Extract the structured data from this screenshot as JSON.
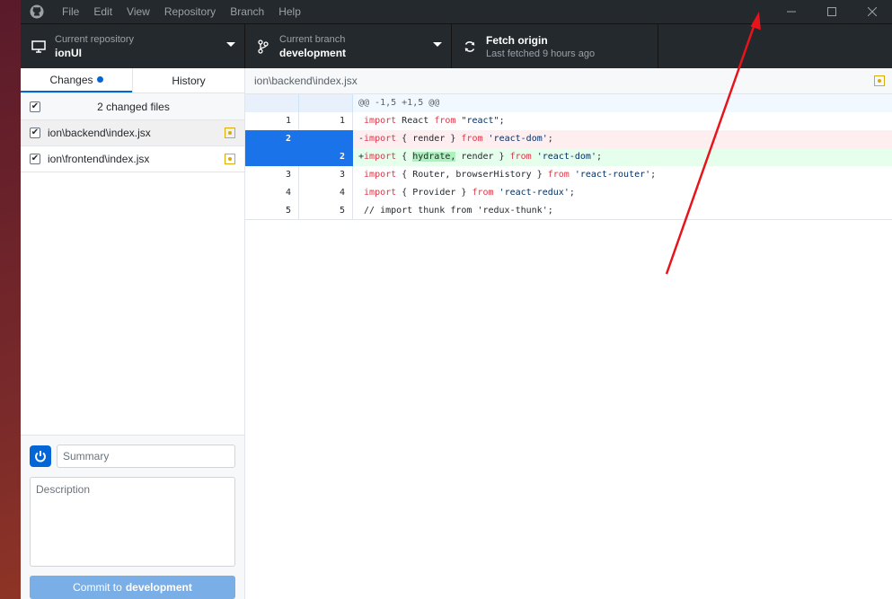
{
  "menu": [
    "File",
    "Edit",
    "View",
    "Repository",
    "Branch",
    "Help"
  ],
  "toolbar": {
    "repo_label": "Current repository",
    "repo_value": "ionUI",
    "branch_label": "Current branch",
    "branch_value": "development",
    "fetch_title": "Fetch origin",
    "fetch_sub": "Last fetched 9 hours ago"
  },
  "tabs": {
    "changes": "Changes",
    "history": "History"
  },
  "changes": {
    "header": "2 changed files",
    "files": [
      "ion\\backend\\index.jsx",
      "ion\\frontend\\index.jsx"
    ]
  },
  "commit": {
    "summary_placeholder": "Summary",
    "description_placeholder": "Description",
    "button_prefix": "Commit to",
    "button_branch": "development"
  },
  "diff": {
    "path": "ion\\backend\\index.jsx",
    "hunk": "@@ -1,5 +1,5 @@",
    "lines": [
      {
        "old": "1",
        "new": "1",
        "segments": [
          " ",
          "import",
          " React ",
          "from",
          " ",
          "\"react\"",
          ";"
        ]
      },
      {
        "old": "2",
        "new": "",
        "segments": [
          "-",
          "import",
          " { render } ",
          "from",
          " ",
          "'react-dom'",
          ";"
        ]
      },
      {
        "old": "",
        "new": "2",
        "segments": [
          "+",
          "import",
          " { ",
          "hydrate,",
          " render } ",
          "from",
          " ",
          "'react-dom'",
          ";"
        ]
      },
      {
        "old": "3",
        "new": "3",
        "segments": [
          " ",
          "import",
          " { Router, browserHistory } ",
          "from",
          " ",
          "'react-router'",
          ";"
        ]
      },
      {
        "old": "4",
        "new": "4",
        "segments": [
          " ",
          "import",
          " { Provider } ",
          "from",
          " ",
          "'react-redux'",
          ";"
        ]
      },
      {
        "old": "5",
        "new": "5",
        "segments": [
          " // import thunk from 'redux-thunk';"
        ]
      }
    ]
  },
  "colors": {
    "accent": "#0366d6",
    "titlebar": "#24292e",
    "added_bg": "#e6ffed",
    "deleted_bg": "#ffeef0",
    "selected_gutter": "#1a73e8",
    "annotation_arrow": "#e8141b"
  }
}
